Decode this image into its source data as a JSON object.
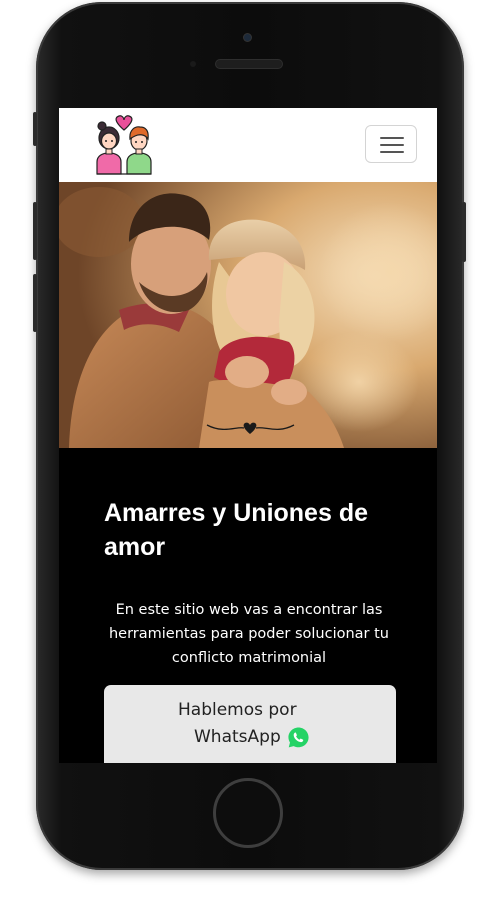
{
  "page": {
    "headline": "Amarres y Uniones de amor",
    "description": "En este sitio web vas a encontrar las herramientas para poder solucionar tu conflicto matrimonial",
    "cta": {
      "line1": "Hablemos por",
      "line2": "WhatsApp"
    }
  },
  "icons": {
    "logo": "couple-heart-logo",
    "menu": "hamburger-menu-icon",
    "whatsapp": "whatsapp-icon"
  },
  "colors": {
    "screen_background": "#000000",
    "navbar_background": "#ffffff",
    "button_background": "#e8e8e8",
    "whatsapp_green": "#25d366",
    "heart_pink": "#e8509a"
  }
}
